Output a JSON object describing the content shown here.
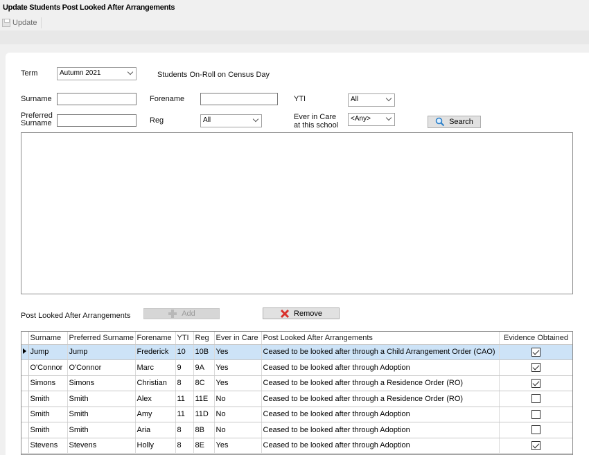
{
  "window": {
    "title": "Update Students Post Looked After Arrangements"
  },
  "toolbar": {
    "update_label": "Update"
  },
  "filters": {
    "term_label": "Term",
    "term_value": "Autumn 2021",
    "census_text": "Students On-Roll on Census Day",
    "surname_label": "Surname",
    "surname_value": "",
    "forename_label": "Forename",
    "forename_value": "",
    "yti_label": "YTI",
    "yti_value": "All",
    "preferred_label_1": "Preferred",
    "preferred_label_2": "Surname",
    "preferred_value": "",
    "reg_label": "Reg",
    "reg_value": "All",
    "ever_care_label_1": "Ever in Care",
    "ever_care_label_2": "at this school",
    "ever_care_value": "<Any>",
    "search_label": "Search"
  },
  "arrangements": {
    "section_label": "Post Looked After Arrangements",
    "add_label": "Add",
    "remove_label": "Remove",
    "columns": [
      "Surname",
      "Preferred Surname",
      "Forename",
      "YTI",
      "Reg",
      "Ever in Care",
      "Post Looked After Arrangements",
      "Evidence Obtained"
    ],
    "rows": [
      {
        "surname": "Jump",
        "preferred": "Jump",
        "forename": "Frederick",
        "yti": "10",
        "reg": "10B",
        "ever_care": "Yes",
        "arrangement": "Ceased to be looked after through a Child Arrangement Order (CAO)",
        "evidence": true
      },
      {
        "surname": "O'Connor",
        "preferred": "O'Connor",
        "forename": "Marc",
        "yti": "9",
        "reg": "9A",
        "ever_care": "Yes",
        "arrangement": "Ceased to be looked after through Adoption",
        "evidence": true
      },
      {
        "surname": "Simons",
        "preferred": "Simons",
        "forename": "Christian",
        "yti": "8",
        "reg": "8C",
        "ever_care": "Yes",
        "arrangement": "Ceased to be looked after through a Residence Order (RO)",
        "evidence": true
      },
      {
        "surname": "Smith",
        "preferred": "Smith",
        "forename": "Alex",
        "yti": "11",
        "reg": "11E",
        "ever_care": "No",
        "arrangement": "Ceased to be looked after through a Residence Order (RO)",
        "evidence": false
      },
      {
        "surname": "Smith",
        "preferred": "Smith",
        "forename": "Amy",
        "yti": "11",
        "reg": "11D",
        "ever_care": "No",
        "arrangement": "Ceased to be looked after through Adoption",
        "evidence": false
      },
      {
        "surname": "Smith",
        "preferred": "Smith",
        "forename": "Aria",
        "yti": "8",
        "reg": "8B",
        "ever_care": "No",
        "arrangement": "Ceased to be looked after through Adoption",
        "evidence": false
      },
      {
        "surname": "Stevens",
        "preferred": "Stevens",
        "forename": "Holly",
        "yti": "8",
        "reg": "8E",
        "ever_care": "Yes",
        "arrangement": "Ceased to be looked after through Adoption",
        "evidence": true
      }
    ]
  }
}
